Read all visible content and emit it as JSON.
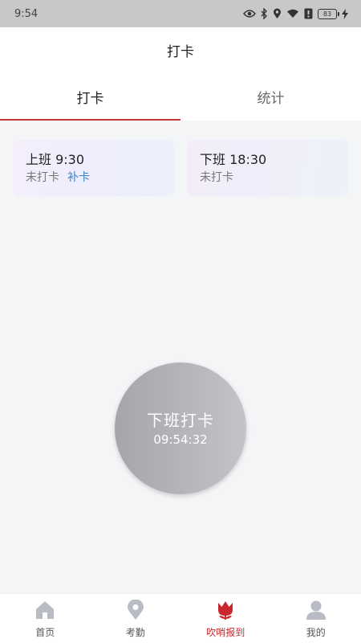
{
  "status_bar": {
    "time": "9:54",
    "battery": "83"
  },
  "header": {
    "title": "打卡"
  },
  "tabs": [
    {
      "label": "打卡",
      "active": true
    },
    {
      "label": "统计",
      "active": false
    }
  ],
  "shifts": [
    {
      "title": "上班 9:30",
      "status": "未打卡",
      "action": "补卡"
    },
    {
      "title": "下班 18:30",
      "status": "未打卡"
    }
  ],
  "punch": {
    "label": "下班打卡",
    "time": "09:54:32"
  },
  "bottom_nav": [
    {
      "label": "首页",
      "icon": "home-icon"
    },
    {
      "label": "考勤",
      "icon": "location-pin-icon"
    },
    {
      "label": "吹哨报到",
      "icon": "tulip-icon",
      "active": true
    },
    {
      "label": "我的",
      "icon": "user-icon"
    }
  ],
  "colors": {
    "accent": "#c7373a",
    "link": "#3a83c9",
    "nav_active": "#c8282d"
  }
}
